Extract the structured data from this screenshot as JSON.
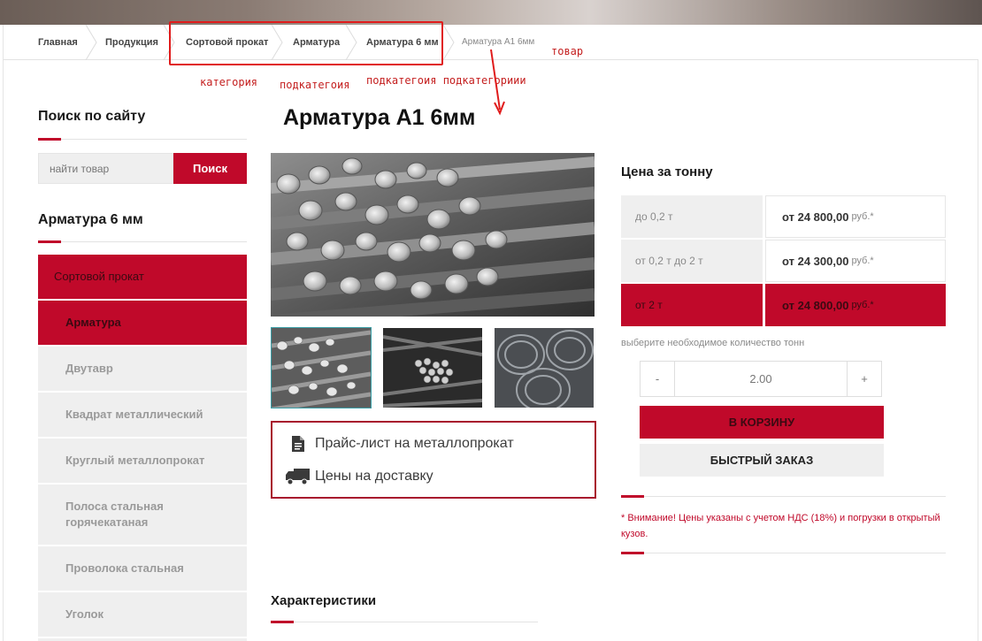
{
  "breadcrumbs": {
    "items": [
      "Главная",
      "Продукция",
      "Сортовой прокат",
      "Арматура",
      "Арматура 6 мм"
    ],
    "current": "Арматура А1 6мм"
  },
  "annotations": {
    "category": "категория",
    "subcategory": "подкатегоия",
    "sub_subcategory": "подкатегоия подкатегориии",
    "product": "товар",
    "color": "#e01b1b"
  },
  "sidebar": {
    "search_heading": "Поиск по сайту",
    "search_placeholder": "найти товар",
    "search_button": "Поиск",
    "category_heading": "Арматура 6 мм",
    "parent_category": "Сортовой прокат",
    "items": [
      {
        "label": "Арматура",
        "active": true
      },
      {
        "label": "Двутавр",
        "active": false
      },
      {
        "label": "Квадрат металлический",
        "active": false
      },
      {
        "label": "Круглый металлопрокат",
        "active": false
      },
      {
        "label": "Полоса стальная горячекатаная",
        "active": false
      },
      {
        "label": "Проволока стальная",
        "active": false
      },
      {
        "label": "Уголок",
        "active": false
      }
    ]
  },
  "product": {
    "title": "Арматура А1 6мм",
    "images": [
      "rebar-bundle-main",
      "rebar-bundle-thumb",
      "rebar-ends-thumb",
      "wire-coils-thumb"
    ],
    "links": [
      {
        "icon": "document-icon",
        "label": "Прайс-лист на металлопрокат"
      },
      {
        "icon": "truck-icon",
        "label": "Цены на доставку"
      }
    ],
    "characteristics_heading": "Характеристики"
  },
  "pricing": {
    "heading": "Цена за тонну",
    "rows": [
      {
        "range": "до 0,2 т",
        "price": "от 24 800,00",
        "unit": "руб.*",
        "highlighted": false
      },
      {
        "range": "от 0,2 т до 2 т",
        "price": "от 24 300,00",
        "unit": "руб.*",
        "highlighted": false
      },
      {
        "range": "от 2 т",
        "price": "от 24 800,00",
        "unit": "руб.*",
        "highlighted": true
      }
    ],
    "qty_label": "выберите необходимое количество тонн",
    "qty_minus": "-",
    "qty_plus": "+",
    "qty_value": "2.00",
    "cart_button": "В КОРЗИНУ",
    "quick_order_button": "БЫСТРЫЙ ЗАКАЗ",
    "note": "* Внимание! Цены указаны с учетом НДС (18%) и погрузки в открытый кузов."
  },
  "colors": {
    "accent": "#c0092a",
    "gray_bg": "#efefef"
  }
}
